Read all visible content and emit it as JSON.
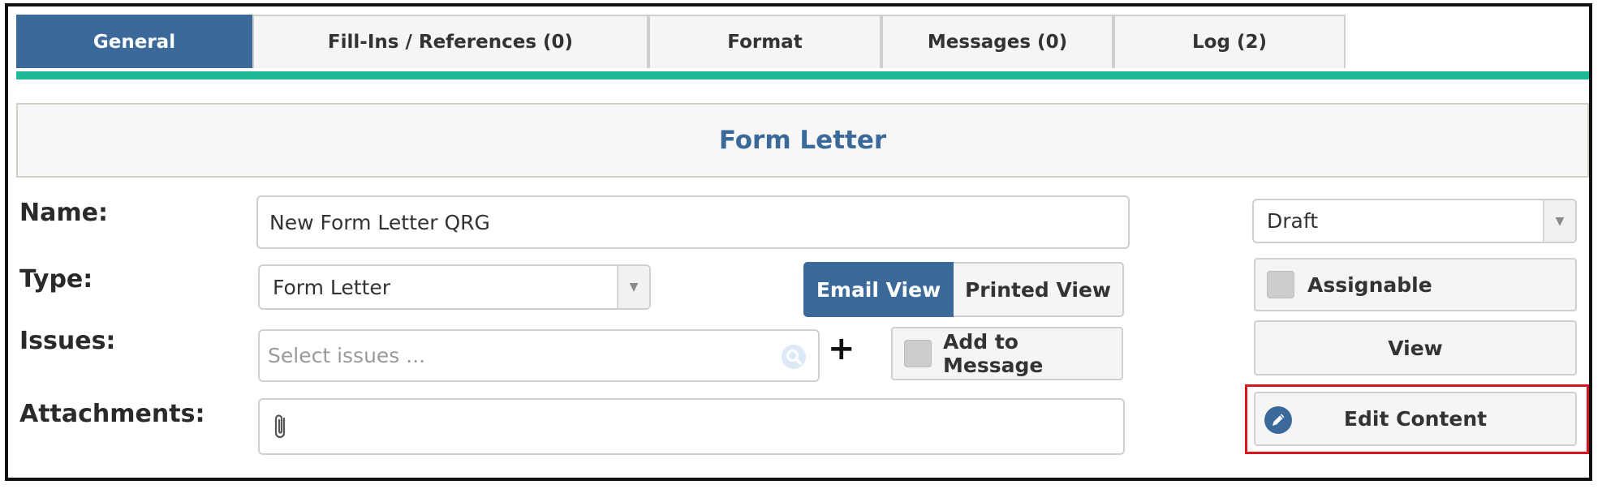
{
  "tabs": [
    {
      "label": "General",
      "active": true
    },
    {
      "label": "Fill-Ins / References (0)",
      "active": false
    },
    {
      "label": "Format",
      "active": false
    },
    {
      "label": "Messages (0)",
      "active": false
    },
    {
      "label": "Log (2)",
      "active": false
    }
  ],
  "panel_title": "Form Letter",
  "form": {
    "name_label": "Name:",
    "name_value": "New Form Letter QRG",
    "type_label": "Type:",
    "type_value": "Form Letter",
    "issues_label": "Issues:",
    "issues_placeholder": "Select issues ...",
    "attachments_label": "Attachments:",
    "plus_symbol": "+"
  },
  "view_toggle": {
    "email_view": "Email View",
    "printed_view": "Printed View",
    "selected": "Email View"
  },
  "add_to_message": {
    "label": "Add to Message",
    "checked": false
  },
  "status_select": {
    "value": "Draft"
  },
  "assignable": {
    "label": "Assignable",
    "checked": false
  },
  "view_button": "View",
  "edit_content_button": "Edit Content",
  "colors": {
    "accent": "#3b6a9a",
    "tab_underline": "#1fb99a",
    "highlight": "#d9141e"
  },
  "icons": {
    "search": "search-icon",
    "paperclip": "paperclip-icon",
    "pencil": "pencil-icon",
    "dropdown": "chevron-down-icon"
  }
}
